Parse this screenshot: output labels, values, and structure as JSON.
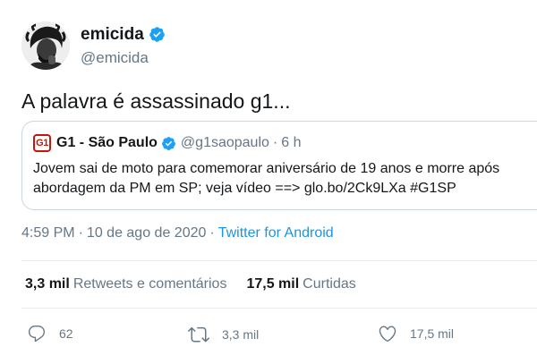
{
  "author": {
    "display_name": "emicida",
    "handle": "@emicida"
  },
  "tweet": {
    "text": "A palavra é assassinado g1..."
  },
  "quoted": {
    "logo_text": "G1",
    "name": "G1 - São Paulo",
    "handle": "@g1saopaulo",
    "separator": "·",
    "time": "6 h",
    "text": "Jovem sai de moto para comemorar aniversário de 19 anos e morre após abordagem da PM em SP; veja vídeo ==> glo.bo/2Ck9LXa #G1SP"
  },
  "meta": {
    "time": "4:59 PM",
    "separator": "·",
    "date": "10 de ago de 2020",
    "source": "Twitter for Android"
  },
  "stats": {
    "retweets_count": "3,3 mil",
    "retweets_label": "Retweets e comentários",
    "likes_count": "17,5 mil",
    "likes_label": "Curtidas"
  },
  "actions": {
    "reply_count": "62",
    "retweet_count": "3,3 mil",
    "like_count": "17,5 mil"
  },
  "colors": {
    "verified": "#1da1f2",
    "link": "#1b95e0",
    "muted": "#657786",
    "g1_red": "#c4170c"
  }
}
